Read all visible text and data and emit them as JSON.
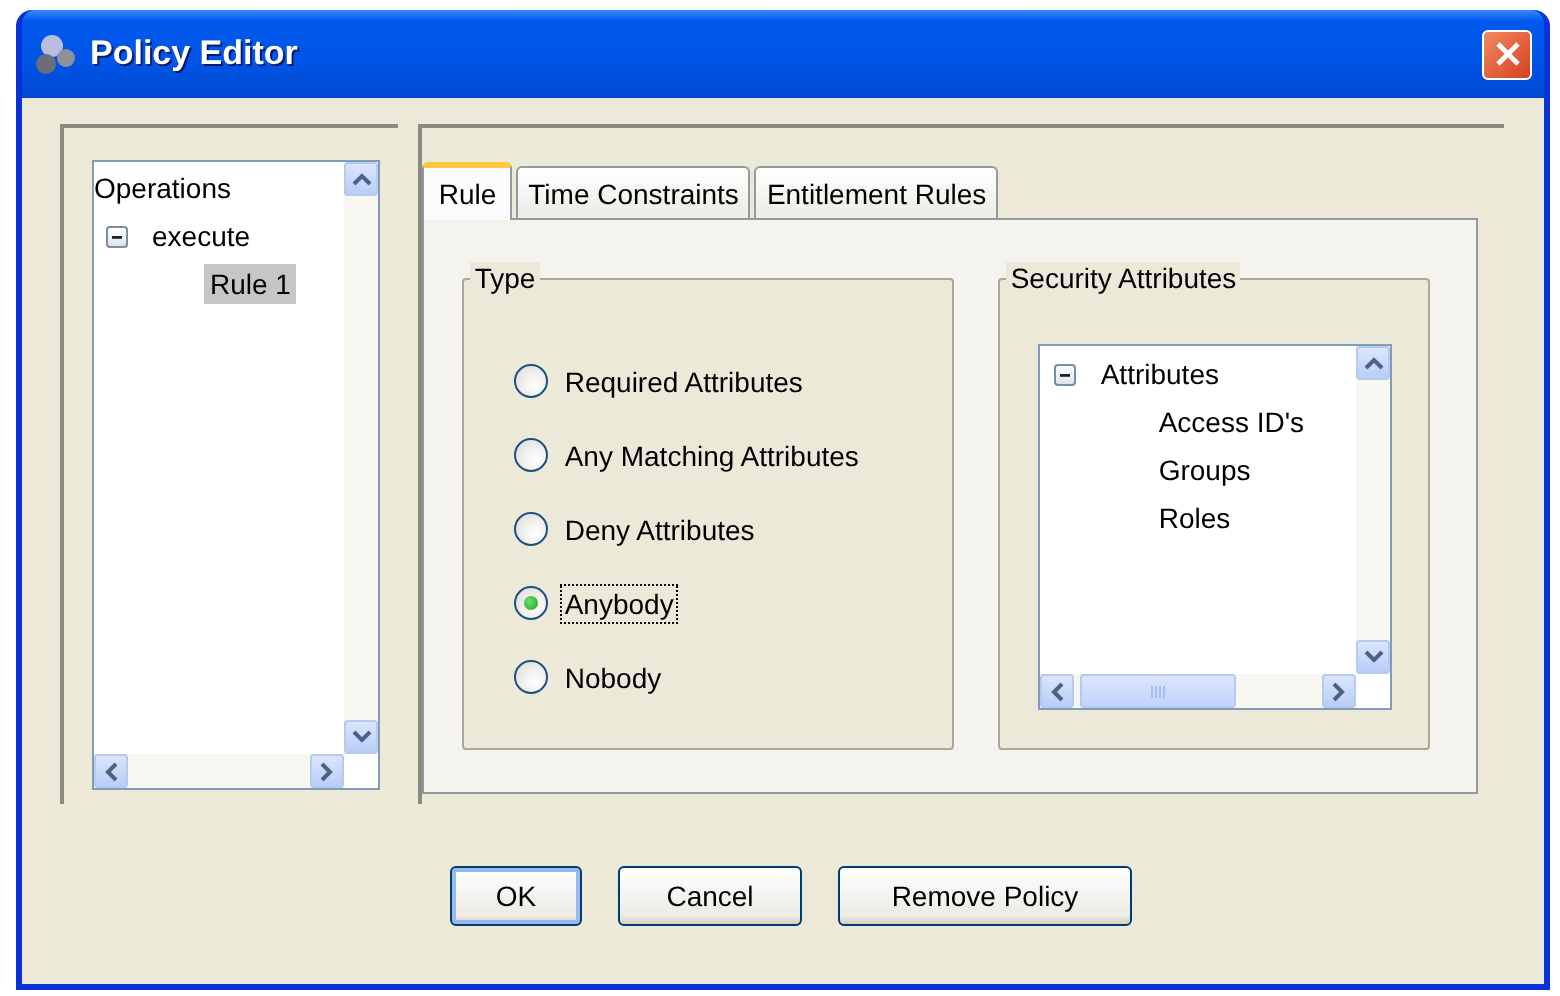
{
  "window": {
    "title": "Policy Editor"
  },
  "operations_tree": {
    "items": [
      {
        "label": "Operations",
        "children": [
          {
            "label": "execute",
            "expanded": true,
            "children": [
              {
                "label": "Rule 1",
                "selected": true
              }
            ]
          }
        ]
      }
    ]
  },
  "tabs": [
    {
      "label": "Rule",
      "selected": true
    },
    {
      "label": "Time Constraints",
      "selected": false
    },
    {
      "label": "Entitlement Rules",
      "selected": false
    }
  ],
  "type_group": {
    "title": "Type",
    "options": [
      {
        "label": "Required Attributes",
        "selected": false,
        "focused": false
      },
      {
        "label": "Any Matching Attributes",
        "selected": false,
        "focused": false
      },
      {
        "label": "Deny Attributes",
        "selected": false,
        "focused": false
      },
      {
        "label": "Anybody",
        "selected": true,
        "focused": true
      },
      {
        "label": "Nobody",
        "selected": false,
        "focused": false
      }
    ]
  },
  "security_group": {
    "title": "Security Attributes",
    "items": [
      {
        "label": "Attributes",
        "expanded": true,
        "children": [
          {
            "label": "Access ID's",
            "selected": false
          },
          {
            "label": "Groups",
            "selected": false
          },
          {
            "label": "Roles",
            "selected": false
          }
        ]
      }
    ]
  },
  "buttons": [
    {
      "label": "OK",
      "default": true
    },
    {
      "label": "Cancel",
      "default": false
    },
    {
      "label": "Remove Policy",
      "default": false
    }
  ]
}
